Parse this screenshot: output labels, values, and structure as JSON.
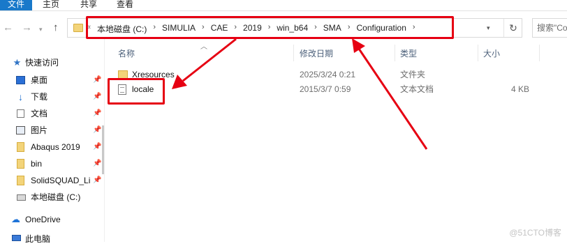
{
  "ribbon": {
    "tabs": [
      "文件",
      "主页",
      "共享",
      "查看"
    ]
  },
  "nav": {
    "back_icon": "arrow-left-icon",
    "forward_icon": "arrow-right-icon",
    "recent_icon": "chevron-down-icon",
    "up_icon": "arrow-up-icon"
  },
  "address_bar": {
    "overflow_chevron": "«",
    "breadcrumbs": [
      "本地磁盘 (C:)",
      "SIMULIA",
      "CAE",
      "2019",
      "win_b64",
      "SMA",
      "Configuration"
    ],
    "separator": "›",
    "refresh_icon": "refresh-icon"
  },
  "search": {
    "placeholder": "搜索\"Co"
  },
  "sidebar": {
    "quick_access": "快速访问",
    "pinned": [
      {
        "label": "桌面",
        "icon": "desktop-icon"
      },
      {
        "label": "下载",
        "icon": "download-icon"
      },
      {
        "label": "文档",
        "icon": "document-icon"
      },
      {
        "label": "图片",
        "icon": "picture-icon"
      },
      {
        "label": "Abaqus 2019",
        "icon": "folder-icon"
      },
      {
        "label": "bin",
        "icon": "folder-icon"
      },
      {
        "label": "SolidSQUAD_Li",
        "icon": "folder-icon"
      }
    ],
    "local_disk": "本地磁盘 (C:)",
    "onedrive": "OneDrive",
    "this_pc": "此电脑"
  },
  "columns": {
    "name": "名称",
    "date": "修改日期",
    "type": "类型",
    "size": "大小"
  },
  "files": [
    {
      "name": "Xresources",
      "date": "2025/3/24 0:21",
      "type": "文件夹",
      "size": "",
      "icon": "folder-icon"
    },
    {
      "name": "locale",
      "date": "2015/3/7 0:59",
      "type": "文本文档",
      "size": "4 KB",
      "icon": "text-file-icon"
    }
  ],
  "annotation": {
    "color": "#e60012"
  },
  "watermark": "@51CTO博客"
}
